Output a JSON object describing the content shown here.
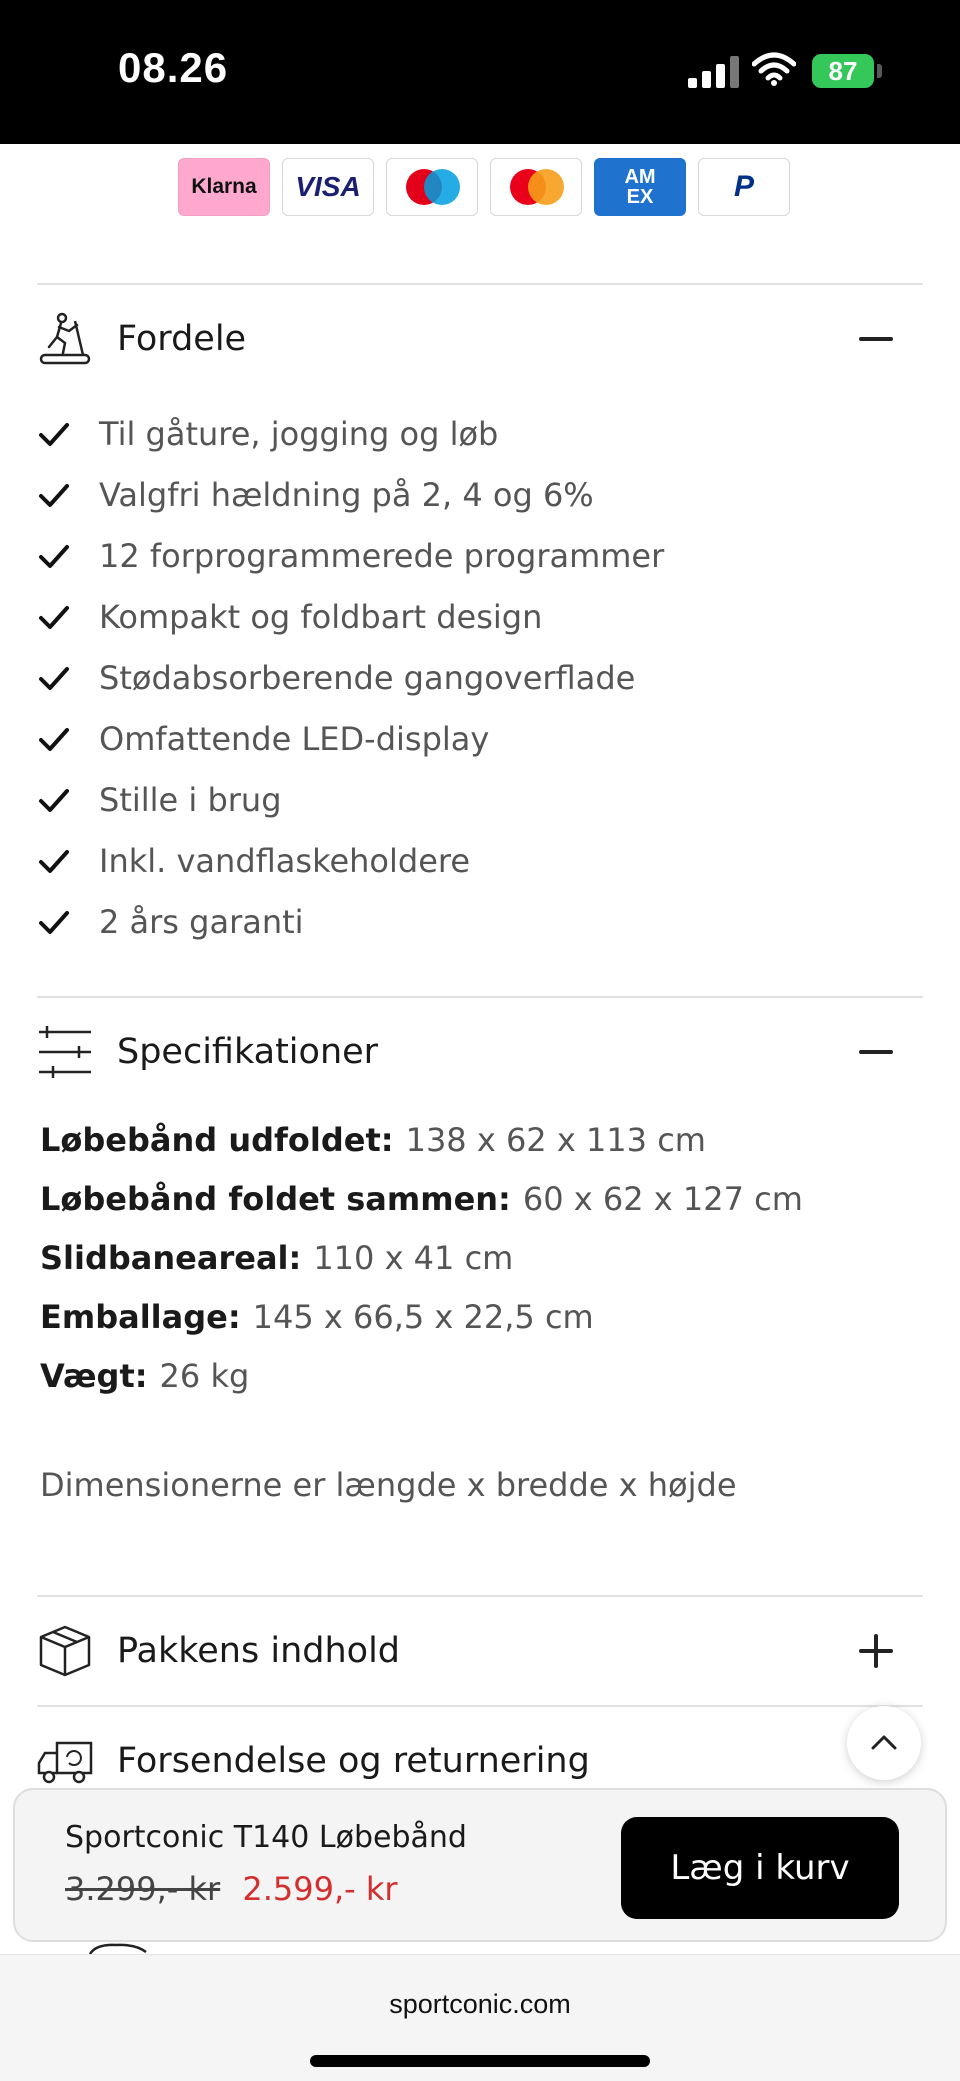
{
  "status_bar": {
    "time": "08.26",
    "battery": "87"
  },
  "payment_methods": [
    {
      "name": "Klarna",
      "label": "Klarna"
    },
    {
      "name": "Visa",
      "label": "VISA"
    },
    {
      "name": "Maestro",
      "label": ""
    },
    {
      "name": "Mastercard",
      "label": ""
    },
    {
      "name": "American Express",
      "label_top": "AM",
      "label_bottom": "EX"
    },
    {
      "name": "PayPal",
      "label": "P"
    }
  ],
  "benefits": {
    "title": "Fordele",
    "icon": "treadmill-icon",
    "expanded": true,
    "items": [
      "Til gåture, jogging og løb",
      "Valgfri hældning på 2, 4 og 6%",
      "12 forprogrammerede programmer",
      "Kompakt og foldbart design",
      "Stødabsorberende gangoverflade",
      "Omfattende LED-display",
      "Stille i brug",
      "Inkl. vandflaskeholdere",
      "2 års garanti"
    ]
  },
  "specifications": {
    "title": "Specifikationer",
    "icon": "sliders-icon",
    "expanded": true,
    "rows": [
      {
        "label": "Løbebånd udfoldet:",
        "value": "138 x 62 x 113 cm"
      },
      {
        "label": "Løbebånd foldet sammen:",
        "value": "60 x 62 x 127 cm"
      },
      {
        "label": "Slidbaneareal:",
        "value": "110 x 41 cm"
      },
      {
        "label": "Emballage:",
        "value": "145 x 66,5 x 22,5 cm"
      },
      {
        "label": "Vægt:",
        "value": "26 kg"
      }
    ],
    "note": "Dimensionerne er længde x bredde x højde"
  },
  "package_contents": {
    "title": "Pakkens indhold",
    "icon": "box-icon",
    "expanded": false
  },
  "shipping": {
    "title": "Forsendelse og returnering",
    "icon": "truck-icon",
    "expanded": false
  },
  "sticky_cart": {
    "product_name": "Sportconic T140 Løbebånd",
    "old_price": "3.299,- kr",
    "new_price": "2.599,- kr",
    "button_label": "Læg i kurv"
  },
  "browser": {
    "url": "sportconic.com"
  },
  "colors": {
    "sale_red": "#d32f2f",
    "battery_green": "#34c759",
    "button_black": "#000000"
  }
}
